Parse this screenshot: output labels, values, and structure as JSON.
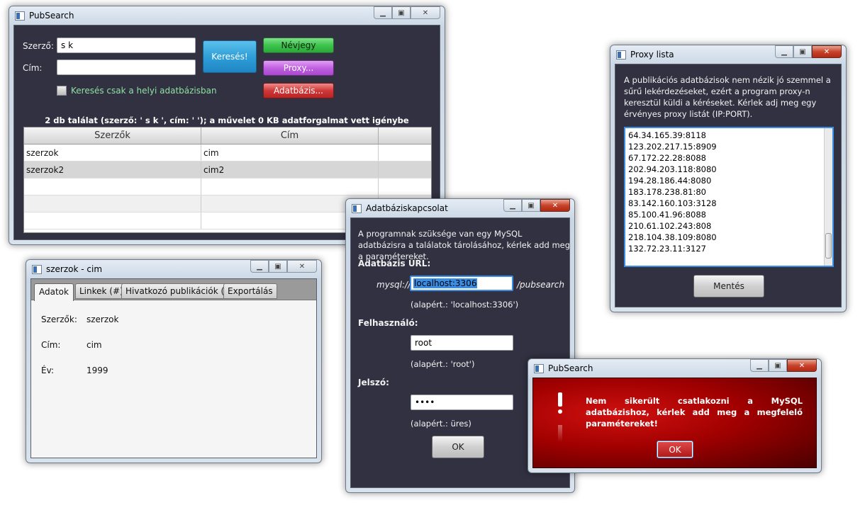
{
  "main": {
    "title": "PubSearch",
    "author_label": "Szerző:",
    "author_value": "s k",
    "title_label": "Cím:",
    "title_value": "",
    "search_button": "Keresés!",
    "about_button": "Névjegy",
    "proxy_button": "Proxy...",
    "db_button": "Adatbázis...",
    "local_checkbox": "Keresés csak a helyi adatbázisban",
    "status": "2 db találat (szerző: ' s k ', cím: '  '); a művelet 0 KB adatforgalmat vett igénybe",
    "columns": [
      "Szerzők",
      "Cím"
    ],
    "rows": [
      {
        "author": "szerzok",
        "title": "cim"
      },
      {
        "author": "szerzok2",
        "title": "cim2"
      }
    ]
  },
  "details": {
    "title": "szerzok - cim",
    "tabs": [
      "Adatok",
      "Linkek (#)",
      "Hivatkozó publikációk (#)",
      "Exportálás"
    ],
    "fields": [
      {
        "label": "Szerzők:",
        "value": "szerzok"
      },
      {
        "label": "Cím:",
        "value": "cim"
      },
      {
        "label": "Év:",
        "value": "1999"
      }
    ]
  },
  "db": {
    "title": "Adatbáziskapcsolat",
    "intro": "A programnak szüksége van egy MySQL adatbázisra a találatok tárolásához, kérlek add meg a paramétereket.",
    "url_label": "Adatbázis URL:",
    "url_prefix": "mysql://",
    "url_value": "localhost:3306",
    "url_suffix": "/pubsearch",
    "url_default": "(alapért.: 'localhost:3306')",
    "user_label": "Felhasználó:",
    "user_value": "root",
    "user_default": "(alapért.: 'root')",
    "pass_label": "Jelszó:",
    "pass_value": "••••",
    "pass_default": "(alapért.: üres)",
    "ok": "OK"
  },
  "proxy": {
    "title": "Proxy lista",
    "intro": "A publikációs adatbázisok nem nézik jó szemmel a sűrű lekérdezéseket, ezért a program proxy-n keresztül küldi a kéréseket. Kérlek adj meg egy érvényes proxy listát (IP:PORT).",
    "list": [
      "64.34.165.39:8118",
      "123.202.217.15:8909",
      "67.172.22.28:8088",
      "202.94.203.118:8080",
      "194.28.186.44:8080",
      "183.178.238.81:80",
      "83.142.160.103:3128",
      "85.100.41.96:8088",
      "210.61.102.243:808",
      "218.104.38.109:8080",
      "132.72.23.11:3127"
    ],
    "save": "Mentés"
  },
  "error": {
    "title": "PubSearch",
    "message": "Nem sikerült csatlakozni a MySQL adatbázishoz, kérlek add meg a megfelelő paramétereket!",
    "ok": "OK"
  },
  "colors": {
    "dark_bg": "#313142",
    "about_green": "#3cc44c",
    "proxy_purple": "#c060e0",
    "db_red": "#d03838",
    "search_blue": "#2f9fd8",
    "error_red": "#a00000"
  }
}
